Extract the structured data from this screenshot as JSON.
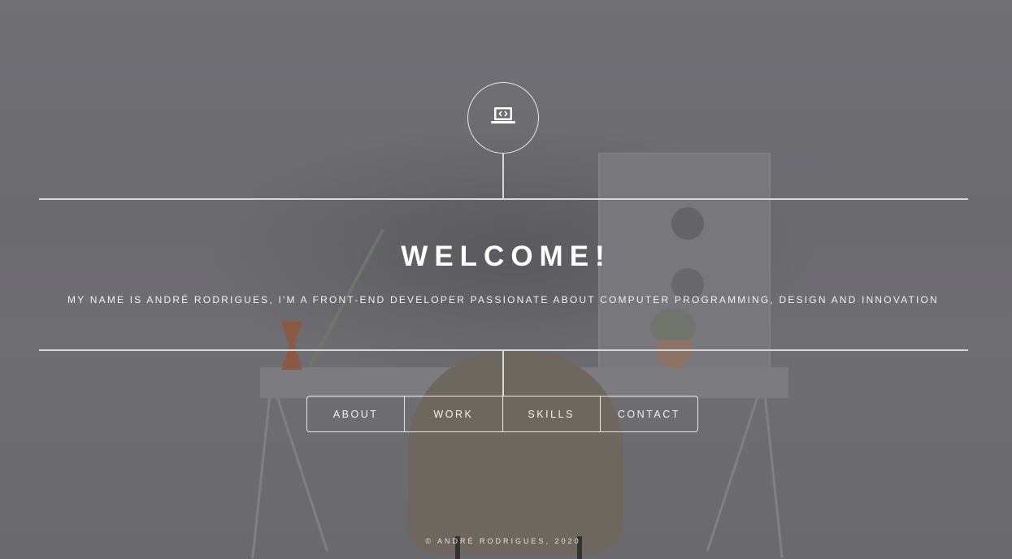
{
  "hero": {
    "icon": "laptop-code-icon",
    "title": "WELCOME!",
    "subtitle": "MY NAME IS ANDRÉ RODRIGUES, I'M A FRONT-END DEVELOPER PASSIONATE ABOUT COMPUTER PROGRAMMING, DESIGN AND INNOVATION"
  },
  "nav": {
    "items": [
      {
        "label": "ABOUT"
      },
      {
        "label": "WORK"
      },
      {
        "label": "SKILLS"
      },
      {
        "label": "CONTACT"
      }
    ]
  },
  "footer": {
    "text": "© ANDRÉ RODRIGUES, 2020"
  },
  "colors": {
    "overlay": "#6b6a6f",
    "foreground": "#ffffff",
    "line": "#d8d8da"
  }
}
